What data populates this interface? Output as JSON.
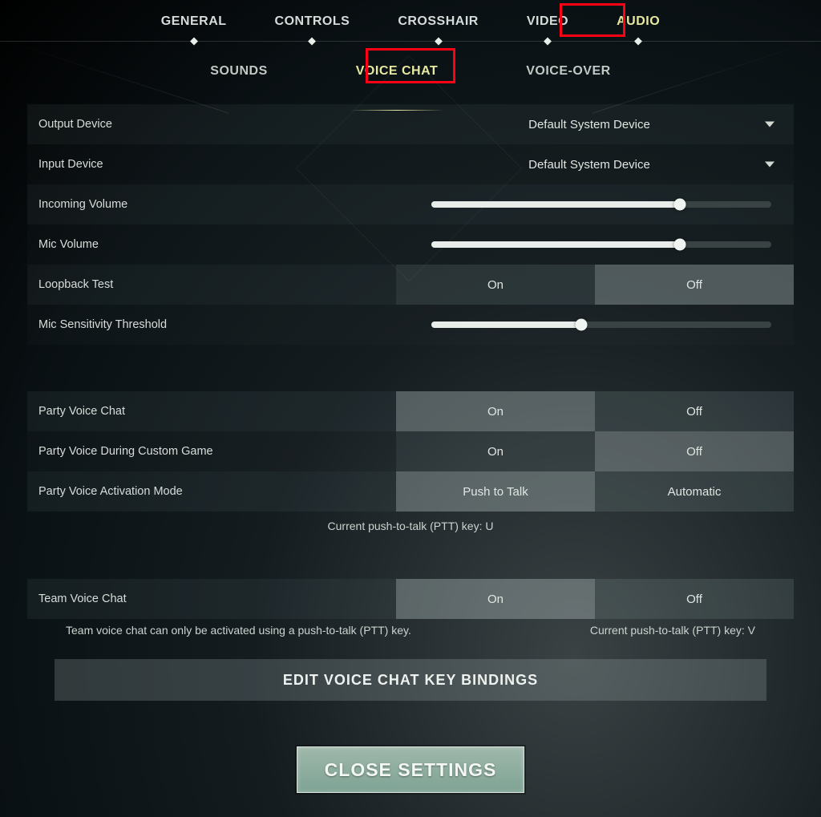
{
  "main_tabs": {
    "general": "GENERAL",
    "controls": "CONTROLS",
    "crosshair": "CROSSHAIR",
    "video": "VIDEO",
    "audio": "AUDIO",
    "active": "audio"
  },
  "sub_tabs": {
    "sounds": "SOUNDS",
    "voice_chat": "VOICE CHAT",
    "voice_over": "VOICE-OVER",
    "active": "voice_chat"
  },
  "rows": {
    "output_device": {
      "label": "Output Device",
      "value": "Default System Device"
    },
    "input_device": {
      "label": "Input Device",
      "value": "Default System Device"
    },
    "incoming_volume": {
      "label": "Incoming Volume",
      "percent": 73
    },
    "mic_volume": {
      "label": "Mic Volume",
      "percent": 73
    },
    "loopback_test": {
      "label": "Loopback Test",
      "opt_a": "On",
      "opt_b": "Off",
      "selected": "b"
    },
    "mic_sensitivity": {
      "label": "Mic Sensitivity Threshold",
      "percent": 44
    },
    "party_voice": {
      "label": "Party Voice Chat",
      "opt_a": "On",
      "opt_b": "Off",
      "selected": "a"
    },
    "party_voice_custom": {
      "label": "Party Voice During Custom Game",
      "opt_a": "On",
      "opt_b": "Off",
      "selected": "b"
    },
    "party_activation": {
      "label": "Party Voice Activation Mode",
      "opt_a": "Push to Talk",
      "opt_b": "Automatic",
      "selected": "a"
    },
    "party_ptt_note": "Current push-to-talk (PTT) key: U",
    "team_voice": {
      "label": "Team Voice Chat",
      "opt_a": "On",
      "opt_b": "Off",
      "selected": "a"
    },
    "team_note_left": "Team voice chat can only be activated using a push-to-talk (PTT) key.",
    "team_note_right": "Current push-to-talk (PTT) key: V"
  },
  "edit_bindings_label": "EDIT VOICE CHAT KEY BINDINGS",
  "close_label": "CLOSE SETTINGS",
  "highlight_audio": true,
  "highlight_voicechat": true
}
